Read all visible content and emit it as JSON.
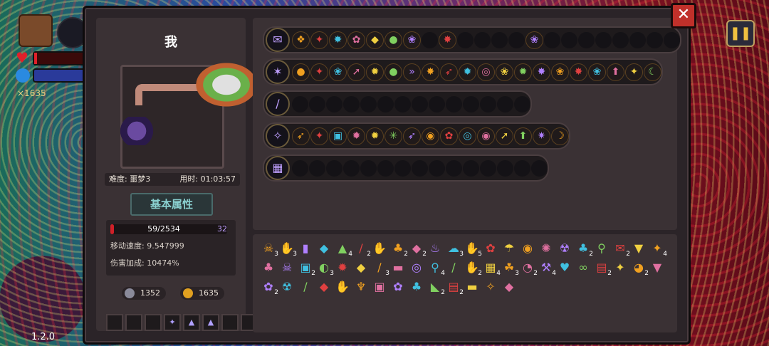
{
  "hud": {
    "coins": "×1635",
    "version": "1.2.0",
    "hp_fraction": 0.06
  },
  "panel": {
    "name": "我",
    "difficulty": "难度: 噩梦3",
    "time": "用时: 01:03:57",
    "attr_button": "基本属性",
    "hp_text": "59/2534",
    "shield": "32",
    "move_speed": "移动速度: 9.547999",
    "damage_bonus": "伤害加成: 10474%",
    "keys": "1352",
    "gold": "1635",
    "slots": [
      "",
      "",
      "",
      "✦",
      "▲",
      "▲",
      "",
      ""
    ]
  },
  "wands": [
    {
      "icon": "✉",
      "spells": [
        "❖",
        "✦",
        "✸",
        "✿",
        "◆",
        "●",
        "❀",
        "",
        "✸",
        "",
        "",
        "",
        "",
        "❀",
        "",
        "",
        "",
        "",
        "",
        "",
        "",
        ""
      ],
      "len": 22
    },
    {
      "icon": "✶",
      "spells": [
        "●",
        "✦",
        "❀",
        "➚",
        "✹",
        "●",
        "»",
        "✸",
        "➶",
        "✹",
        "◎",
        "❀",
        "✹",
        "✸",
        "❀",
        "✸",
        "❀",
        "⬆",
        "✦",
        "☾"
      ],
      "len": 20
    },
    {
      "icon": "/",
      "spells": [
        "",
        "",
        "",
        "",
        "",
        "",
        "",
        "",
        "",
        "",
        "",
        "",
        "",
        ""
      ],
      "len": 14
    },
    {
      "icon": "✧",
      "spells": [
        "➶",
        "✦",
        "▣",
        "✹",
        "✹",
        "✳",
        "➶",
        "◉",
        "✿",
        "◎",
        "◉",
        "➚",
        "⬆",
        "✷",
        "☽"
      ],
      "len": 15
    },
    {
      "icon": "▦",
      "spells": [
        "",
        "",
        "",
        "",
        "",
        "",
        "",
        "",
        "",
        "",
        "",
        "",
        "",
        "",
        ""
      ],
      "len": 15
    }
  ],
  "items": [
    {
      "g": "☠",
      "c": "3"
    },
    {
      "g": "✋",
      "c": "3"
    },
    {
      "g": "▮",
      "c": ""
    },
    {
      "g": "◆",
      "c": ""
    },
    {
      "g": "▲",
      "c": "4"
    },
    {
      "g": "/",
      "c": "2"
    },
    {
      "g": "✋",
      "c": ""
    },
    {
      "g": "♣",
      "c": "2"
    },
    {
      "g": "◆",
      "c": "2"
    },
    {
      "g": "♨",
      "c": ""
    },
    {
      "g": "☁",
      "c": "3"
    },
    {
      "g": "✋",
      "c": "5"
    },
    {
      "g": "✿",
      "c": ""
    },
    {
      "g": "☂",
      "c": ""
    },
    {
      "g": "◉",
      "c": ""
    },
    {
      "g": "✺",
      "c": ""
    },
    {
      "g": "☢",
      "c": ""
    },
    {
      "g": "♣",
      "c": "2"
    },
    {
      "g": "⚲",
      "c": ""
    },
    {
      "g": "✉",
      "c": "2"
    },
    {
      "g": "▼",
      "c": ""
    },
    {
      "g": "✦",
      "c": "4"
    },
    {
      "g": "♣",
      "c": ""
    },
    {
      "g": "☠",
      "c": ""
    },
    {
      "g": "▣",
      "c": "2"
    },
    {
      "g": "◐",
      "c": "3"
    },
    {
      "g": "✹",
      "c": ""
    },
    {
      "g": "◆",
      "c": ""
    },
    {
      "g": "∕",
      "c": "3"
    },
    {
      "g": "▬",
      "c": ""
    },
    {
      "g": "◎",
      "c": ""
    },
    {
      "g": "⚲",
      "c": "4"
    },
    {
      "g": "/",
      "c": ""
    },
    {
      "g": "✋",
      "c": "2"
    },
    {
      "g": "▦",
      "c": "4"
    },
    {
      "g": "☘",
      "c": "3"
    },
    {
      "g": "◔",
      "c": "2"
    },
    {
      "g": "⚒",
      "c": "4"
    },
    {
      "g": "♥",
      "c": ""
    },
    {
      "g": "∞",
      "c": ""
    },
    {
      "g": "▤",
      "c": "2"
    },
    {
      "g": "✦",
      "c": ""
    },
    {
      "g": "◕",
      "c": "2"
    },
    {
      "g": "▼",
      "c": ""
    },
    {
      "g": "✿",
      "c": "2"
    },
    {
      "g": "☢",
      "c": ""
    },
    {
      "g": "/",
      "c": ""
    },
    {
      "g": "◆",
      "c": ""
    },
    {
      "g": "✋",
      "c": ""
    },
    {
      "g": "♆",
      "c": ""
    },
    {
      "g": "▣",
      "c": ""
    },
    {
      "g": "✿",
      "c": ""
    },
    {
      "g": "♣",
      "c": ""
    },
    {
      "g": "◣",
      "c": "2"
    },
    {
      "g": "▤",
      "c": "2"
    },
    {
      "g": "▬",
      "c": ""
    },
    {
      "g": "✧",
      "c": ""
    },
    {
      "g": "◆",
      "c": ""
    }
  ]
}
